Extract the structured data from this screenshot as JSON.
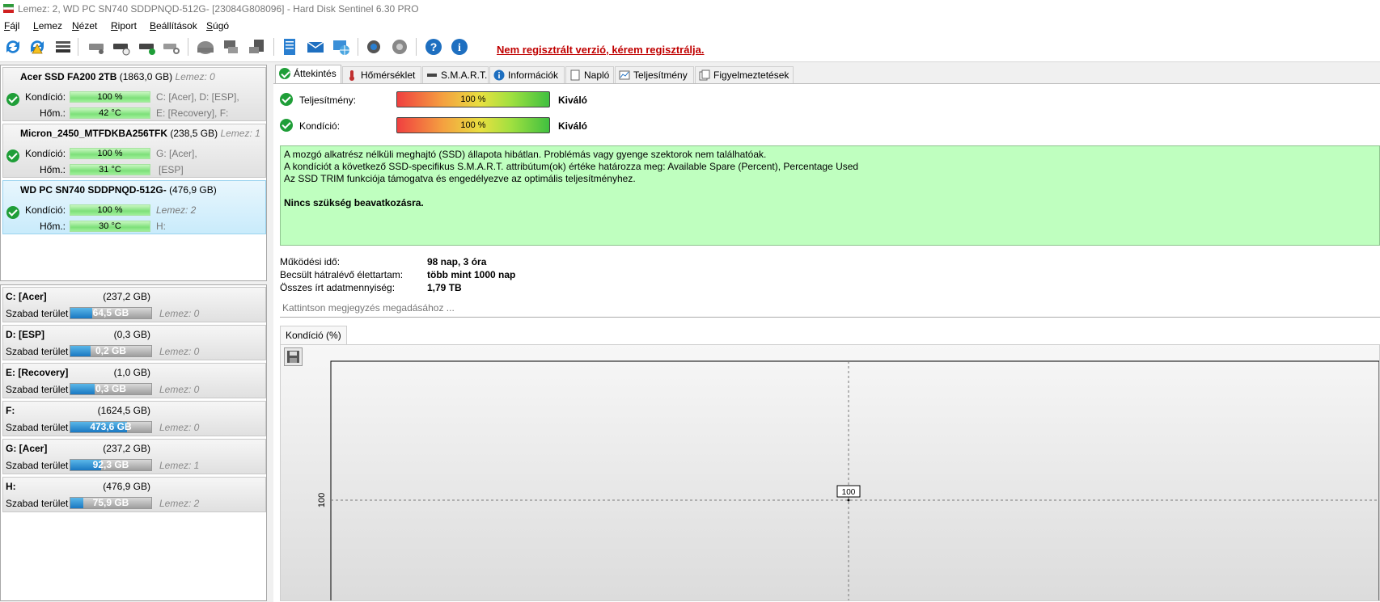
{
  "window": {
    "title": "Lemez: 2, WD PC SN740 SDDPNQD-512G- [23084G808096]  -  Hard Disk Sentinel 6.30 PRO"
  },
  "menu": [
    "Fájl",
    "Lemez",
    "Nézet",
    "Riport",
    "Beállítások",
    "Súgó"
  ],
  "toolbar": {
    "register_link": "Nem regisztrált verzió, kérem regisztrálja."
  },
  "disks": [
    {
      "name": "Acer SSD FA200 2TB",
      "size": "(1863,0 GB)",
      "disk": "Lemez: 0",
      "cond_label": "Kondíció:",
      "cond": "100 %",
      "vol1": "C: [Acer], D: [ESP],",
      "temp_label": "Hőm.:",
      "temp": "42 °C",
      "vol2": "E: [Recovery], F:"
    },
    {
      "name": "Micron_2450_MTFDKBA256TFK",
      "size": "(238,5 GB)",
      "disk": "Lemez: 1",
      "cond_label": "Kondíció:",
      "cond": "100 %",
      "vol1": "G: [Acer],",
      "temp_label": "Hőm.:",
      "temp": "31 °C",
      "vol2": "[ESP]"
    },
    {
      "name": "WD PC SN740 SDDPNQD-512G-",
      "size": "(476,9 GB)",
      "disk": "",
      "cond_label": "Kondíció:",
      "cond": "100 %",
      "vol1": "Lemez: 2",
      "temp_label": "Hőm.:",
      "temp": "30 °C",
      "vol2": "H:"
    }
  ],
  "volumes": [
    {
      "name": "C: [Acer]",
      "size": "(237,2 GB)",
      "free_label": "Szabad terület",
      "free": "64,5 GB",
      "free_pct": 0.27,
      "disk": "Lemez: 0"
    },
    {
      "name": "D: [ESP]",
      "size": "(0,3 GB)",
      "free_label": "Szabad terület",
      "free": "0,2 GB",
      "free_pct": 0.25,
      "disk": "Lemez: 0"
    },
    {
      "name": "E: [Recovery]",
      "size": "(1,0 GB)",
      "free_label": "Szabad terület",
      "free": "0,3 GB",
      "free_pct": 0.3,
      "disk": "Lemez: 0"
    },
    {
      "name": "F:",
      "size": "(1624,5 GB)",
      "free_label": "Szabad terület",
      "free": "473,6 GB",
      "free_pct": 0.7,
      "disk": "Lemez: 0"
    },
    {
      "name": "G: [Acer]",
      "size": "(237,2 GB)",
      "free_label": "Szabad terület",
      "free": "92,3 GB",
      "free_pct": 0.38,
      "disk": "Lemez: 1"
    },
    {
      "name": "H:",
      "size": "(476,9 GB)",
      "free_label": "Szabad terület",
      "free": "75,9 GB",
      "free_pct": 0.16,
      "disk": "Lemez: 2"
    }
  ],
  "tabs": [
    "Áttekintés",
    "Hőmérséklet",
    "S.M.A.R.T.",
    "Információk",
    "Napló",
    "Teljesítmény",
    "Figyelmeztetések"
  ],
  "overview": {
    "perf_label": "Teljesítmény:",
    "perf_value": "100 %",
    "perf_rating": "Kiváló",
    "cond_label": "Kondíció:",
    "cond_value": "100 %",
    "cond_rating": "Kiváló",
    "info_lines": [
      "A mozgó alkatrész nélküli meghajtó (SSD) állapota hibátlan. Problémás vagy gyenge szektorok nem találhatóak.",
      "A kondíciót a következő SSD-specifikus S.M.A.R.T. attribútum(ok) értéke határozza meg:  Available Spare (Percent), Percentage Used",
      "Az SSD TRIM funkciója támogatva és engedélyezve az optimális teljesítményhez."
    ],
    "info_action": "Nincs szükség beavatkozásra.",
    "uptime_label": "Működési idő:",
    "uptime": "98 nap, 3 óra",
    "life_label": "Becsült hátralévő élettartam:",
    "life": "több mint 1000 nap",
    "written_label": "Összes írt adatmennyiség:",
    "written": "1,79 TB",
    "note_placeholder": "Kattintson megjegyzés megadásához ...",
    "chart_tab": "Kondíció  (%)"
  },
  "chart_data": {
    "type": "line",
    "title": "Kondíció  (%)",
    "series": [
      {
        "values": [
          100
        ]
      }
    ],
    "ytick_labels": [
      "100"
    ],
    "data_labels": [
      "100"
    ],
    "grid": true
  }
}
